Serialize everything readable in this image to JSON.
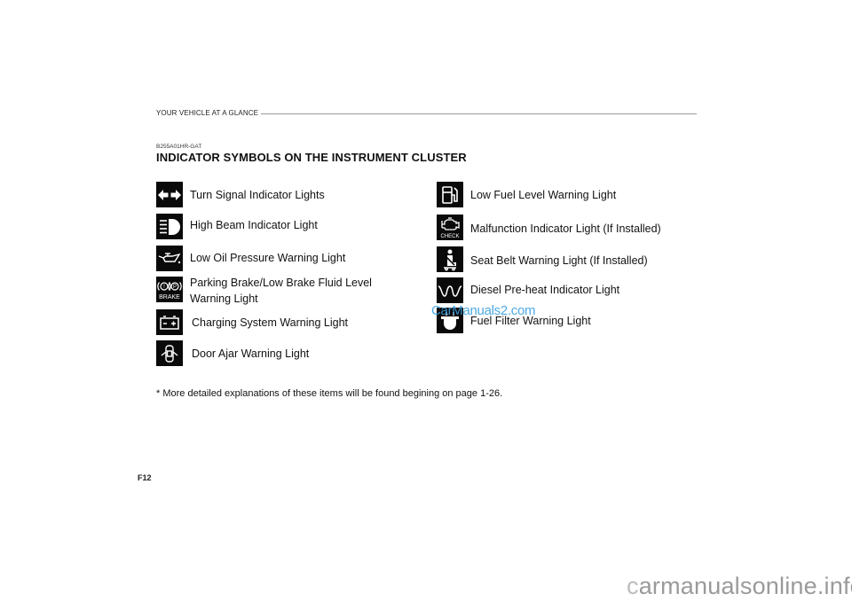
{
  "header": {
    "section": "YOUR VEHICLE AT A GLANCE",
    "code": "B255A01HR-GAT",
    "title": "INDICATOR SYMBOLS ON THE INSTRUMENT CLUSTER"
  },
  "left_items": [
    {
      "icon": "turn-signal-icon",
      "label": "Turn Signal Indicator Lights"
    },
    {
      "icon": "high-beam-icon",
      "label": "High Beam Indicator Light"
    },
    {
      "icon": "oil-pressure-icon",
      "label": "Low Oil Pressure Warning Light"
    },
    {
      "icon": "brake-icon",
      "icon_text": "BRAKE",
      "label_line1": "Parking Brake/Low Brake Fluid Level",
      "label_line2": "Warning Light"
    },
    {
      "icon": "battery-icon",
      "label": "Charging System Warning Light"
    },
    {
      "icon": "door-ajar-icon",
      "label": "Door Ajar Warning Light"
    }
  ],
  "right_items": [
    {
      "icon": "fuel-pump-icon",
      "label": "Low Fuel Level Warning Light"
    },
    {
      "icon": "check-engine-icon",
      "icon_text": "CHECK",
      "label": "Malfunction Indicator Light (If Installed)"
    },
    {
      "icon": "seat-belt-icon",
      "label": "Seat Belt Warning Light (If Installed)"
    },
    {
      "icon": "glow-plug-icon",
      "label": "Diesel Pre-heat Indicator Light"
    },
    {
      "icon": "fuel-filter-icon",
      "label": "Fuel Filter Warning Light"
    }
  ],
  "footnote": "* More detailed explanations of these items will be found begining on page 1-26.",
  "page_number": "F12",
  "watermarks": {
    "overlay": "CarManuals2.com",
    "footer_prefix": "c",
    "footer": "armanualsonline.info"
  }
}
